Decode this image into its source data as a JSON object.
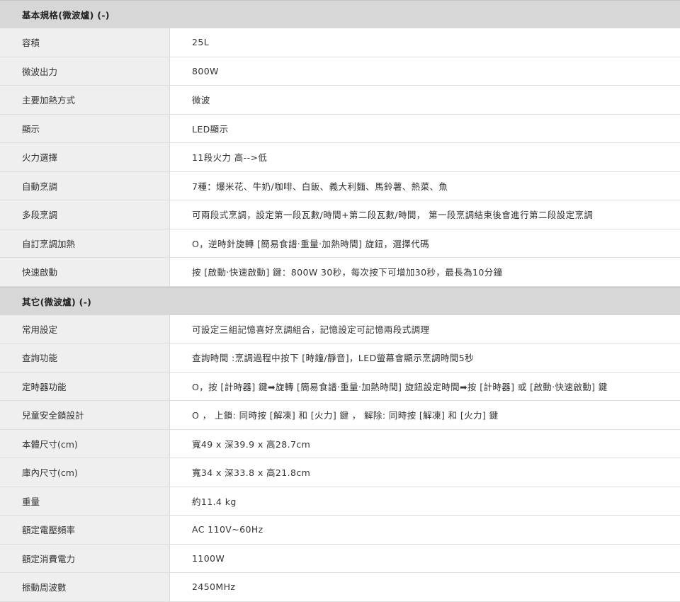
{
  "sections": [
    {
      "title": "基本規格(微波爐) (-)",
      "rows": [
        {
          "label": "容積",
          "value": "25L"
        },
        {
          "label": "微波出力",
          "value": "800W"
        },
        {
          "label": "主要加熱方式",
          "value": "微波"
        },
        {
          "label": "顯示",
          "value": "LED顯示"
        },
        {
          "label": "火力選擇",
          "value": "11段火力 高-->低"
        },
        {
          "label": "自動烹調",
          "value": "7種：爆米花、牛奶/咖啡、白飯、義大利麵、馬鈴薯、熱菜、魚"
        },
        {
          "label": "多段烹調",
          "value": "可兩段式烹調，設定第一段瓦數/時間+第二段瓦數/時間， 第一段烹調結束後會進行第二段設定烹調"
        },
        {
          "label": "自訂烹調加熱",
          "value": "O，逆時針旋轉 [簡易食譜‧重量‧加熱時間] 旋鈕，選擇代碼"
        },
        {
          "label": "快速啟動",
          "value": "按 [啟動‧快速啟動] 鍵：800W 30秒，每次按下可增加30秒，最長為10分鐘"
        }
      ]
    },
    {
      "title": "其它(微波爐) (-)",
      "rows": [
        {
          "label": "常用設定",
          "value": "可設定三組記憶喜好烹調組合，記憶設定可記憶兩段式調理"
        },
        {
          "label": "查詢功能",
          "value": "查詢時間 :烹調過程中按下 [時鐘/靜音]，LED螢幕會顯示烹調時間5秒"
        },
        {
          "label": "定時器功能",
          "value": "O，按 [計時器] 鍵➡旋轉 [簡易食譜‧重量‧加熱時間] 旋鈕設定時間➡按 [計時器] 或 [啟動‧快速啟動] 鍵"
        },
        {
          "label": "兒童安全鎖設計",
          "value": "O ， 上鎖: 同時按 [解凍] 和 [火力] 鍵 ， 解除: 同時按 [解凍] 和 [火力] 鍵"
        },
        {
          "label": "本體尺寸(cm)",
          "value": "寬49 x 深39.9 x 高28.7cm"
        },
        {
          "label": "庫內尺寸(cm)",
          "value": "寬34 x 深33.8 x 高21.8cm"
        },
        {
          "label": "重量",
          "value": "約11.4 kg"
        },
        {
          "label": "額定電壓頻率",
          "value": "AC 110V~60Hz"
        },
        {
          "label": "額定消費電力",
          "value": "1100W"
        },
        {
          "label": "振動周波數",
          "value": "2450MHz"
        }
      ]
    }
  ]
}
